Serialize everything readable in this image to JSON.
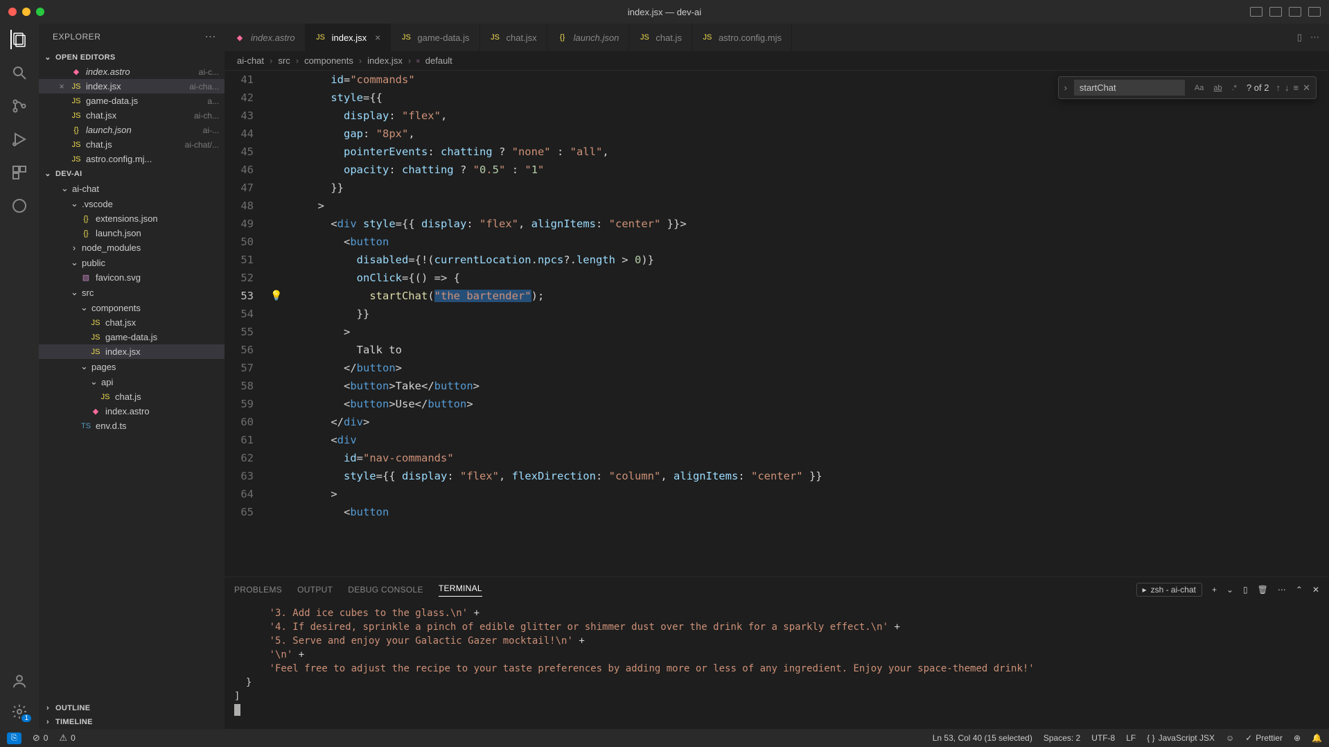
{
  "titlebar": {
    "title": "index.jsx — dev-ai"
  },
  "sidebar": {
    "title": "EXPLORER",
    "sections": {
      "openEditors": "OPEN EDITORS",
      "project": "DEV-AI",
      "outline": "OUTLINE",
      "timeline": "TIMELINE"
    }
  },
  "openEditors": [
    {
      "name": "index.astro",
      "hint": "ai-c...",
      "icon": "astro",
      "italic": true
    },
    {
      "name": "index.jsx",
      "hint": "ai-cha...",
      "icon": "jsx",
      "active": true
    },
    {
      "name": "game-data.js",
      "hint": "a...",
      "icon": "js"
    },
    {
      "name": "chat.jsx",
      "hint": "ai-ch...",
      "icon": "jsx"
    },
    {
      "name": "launch.json",
      "hint": "ai-...",
      "icon": "json",
      "italic": true
    },
    {
      "name": "chat.js",
      "hint": "ai-chat/...",
      "icon": "js"
    },
    {
      "name": "astro.config.mj...",
      "hint": "",
      "icon": "js"
    }
  ],
  "tree": [
    {
      "name": "ai-chat",
      "type": "folder",
      "depth": 1,
      "open": true
    },
    {
      "name": ".vscode",
      "type": "folder",
      "depth": 2,
      "open": true
    },
    {
      "name": "extensions.json",
      "type": "file",
      "depth": 3,
      "icon": "json"
    },
    {
      "name": "launch.json",
      "type": "file",
      "depth": 3,
      "icon": "json"
    },
    {
      "name": "node_modules",
      "type": "folder",
      "depth": 2,
      "open": false
    },
    {
      "name": "public",
      "type": "folder",
      "depth": 2,
      "open": true
    },
    {
      "name": "favicon.svg",
      "type": "file",
      "depth": 3,
      "icon": "svg"
    },
    {
      "name": "src",
      "type": "folder",
      "depth": 2,
      "open": true
    },
    {
      "name": "components",
      "type": "folder",
      "depth": 3,
      "open": true
    },
    {
      "name": "chat.jsx",
      "type": "file",
      "depth": 4,
      "icon": "jsx"
    },
    {
      "name": "game-data.js",
      "type": "file",
      "depth": 4,
      "icon": "js"
    },
    {
      "name": "index.jsx",
      "type": "file",
      "depth": 4,
      "icon": "jsx",
      "selected": true
    },
    {
      "name": "pages",
      "type": "folder",
      "depth": 3,
      "open": true
    },
    {
      "name": "api",
      "type": "folder",
      "depth": 4,
      "open": true
    },
    {
      "name": "chat.js",
      "type": "file",
      "depth": 5,
      "icon": "js"
    },
    {
      "name": "index.astro",
      "type": "file",
      "depth": 4,
      "icon": "astro"
    },
    {
      "name": "env.d.ts",
      "type": "file",
      "depth": 3,
      "icon": "ts"
    }
  ],
  "tabs": [
    {
      "label": "index.astro",
      "icon": "astro",
      "italic": true
    },
    {
      "label": "index.jsx",
      "icon": "jsx",
      "active": true
    },
    {
      "label": "game-data.js",
      "icon": "js"
    },
    {
      "label": "chat.jsx",
      "icon": "jsx"
    },
    {
      "label": "launch.json",
      "icon": "json",
      "italic": true
    },
    {
      "label": "chat.js",
      "icon": "js"
    },
    {
      "label": "astro.config.mjs",
      "icon": "js"
    }
  ],
  "breadcrumb": [
    "ai-chat",
    "src",
    "components",
    "index.jsx",
    "default"
  ],
  "find": {
    "query": "startChat",
    "results": "? of 2"
  },
  "code": {
    "first_line": 41,
    "current_line": 53,
    "lines": [
      "          id=\"commands\"",
      "          style={{",
      "            display: \"flex\",",
      "            gap: \"8px\",",
      "            pointerEvents: chatting ? \"none\" : \"all\",",
      "            opacity: chatting ? \"0.5\" : \"1\"",
      "          }}",
      "        >",
      "          <div style={{ display: \"flex\", alignItems: \"center\" }}>",
      "            <button",
      "              disabled={!(currentLocation.npcs?.length > 0)}",
      "              onClick={() => {",
      "                startChat(\"the bartender\");",
      "              }}",
      "            >",
      "              Talk to",
      "            </button>",
      "            <button>Take</button>",
      "            <button>Use</button>",
      "          </div>",
      "          <div",
      "            id=\"nav-commands\"",
      "            style={{ display: \"flex\", flexDirection: \"column\", alignItems: \"center\" }}",
      "          >",
      "            <button"
    ],
    "selection": {
      "line": 53,
      "text": "\"the bartender\""
    }
  },
  "panel": {
    "tabs": [
      "PROBLEMS",
      "OUTPUT",
      "DEBUG CONSOLE",
      "TERMINAL"
    ],
    "activeTab": "TERMINAL",
    "shell": "zsh - ai-chat"
  },
  "terminal": [
    "      '3. Add ice cubes to the glass.\\n' +",
    "      '4. If desired, sprinkle a pinch of edible glitter or shimmer dust over the drink for a sparkly effect.\\n' +",
    "      '5. Serve and enjoy your Galactic Gazer mocktail!\\n' +",
    "      '\\n' +",
    "      'Feel free to adjust the recipe to your taste preferences by adding more or less of any ingredient. Enjoy your space-themed drink!'",
    "  }",
    "]"
  ],
  "status": {
    "errors": "0",
    "warnings": "0",
    "cursor": "Ln 53, Col 40 (15 selected)",
    "spaces": "Spaces: 2",
    "encoding": "UTF-8",
    "eol": "LF",
    "language": "JavaScript JSX",
    "prettier": "Prettier"
  }
}
